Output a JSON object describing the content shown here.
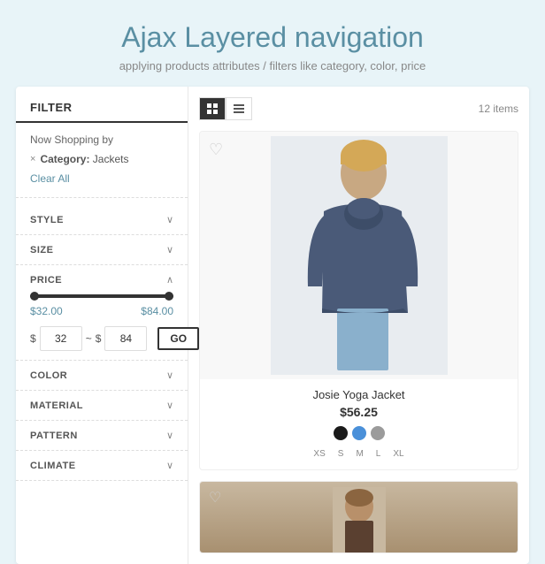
{
  "header": {
    "title": "Ajax Layered navigation",
    "subtitle": "applying products attributes / filters like category, color, price"
  },
  "sidebar": {
    "filter_title": "FILTER",
    "now_shopping": {
      "title": "Now Shopping by",
      "filters": [
        {
          "label": "Category:",
          "value": "Jackets"
        }
      ],
      "clear_label": "Clear All"
    },
    "sections": [
      {
        "label": "STYLE",
        "expanded": false
      },
      {
        "label": "SIZE",
        "expanded": false
      },
      {
        "label": "COLOR",
        "expanded": false
      },
      {
        "label": "MATERIAL",
        "expanded": false
      },
      {
        "label": "PATTERN",
        "expanded": false
      },
      {
        "label": "CLIMATE",
        "expanded": false
      }
    ],
    "price": {
      "label": "PRICE",
      "expanded": true,
      "min_display": "$32.00",
      "max_display": "$84.00",
      "min_value": "32",
      "max_value": "84",
      "currency_symbol": "$",
      "tilde": "~",
      "go_label": "GO"
    }
  },
  "content": {
    "items_count": "12 items",
    "view_modes": [
      {
        "label": "grid",
        "active": true
      },
      {
        "label": "list",
        "active": false
      }
    ],
    "products": [
      {
        "name": "Josie Yoga Jacket",
        "price": "$56.25",
        "colors": [
          "#1a1a1a",
          "#4a90d9",
          "#9b9b9b"
        ],
        "sizes": [
          "XS",
          "S",
          "M",
          "L",
          "XL"
        ]
      }
    ]
  },
  "icons": {
    "chevron_down": "∨",
    "chevron_up": "∧",
    "close_x": "×",
    "heart": "♡",
    "heart_filled": "♡"
  }
}
